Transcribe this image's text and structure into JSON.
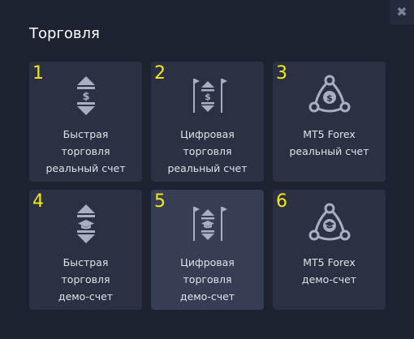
{
  "modal": {
    "title": "Торговля",
    "close_glyph": "✖"
  },
  "cards": [
    {
      "number": "1",
      "icon": "quick-trading-dollar-icon",
      "lines": [
        "Быстрая",
        "торговля",
        "реальный счет"
      ]
    },
    {
      "number": "2",
      "icon": "digital-trading-dollar-icon",
      "lines": [
        "Цифровая",
        "торговля",
        "реальный счет"
      ]
    },
    {
      "number": "3",
      "icon": "mt5-forex-dollar-icon",
      "lines": [
        "MT5 Forex",
        "реальный счет"
      ]
    },
    {
      "number": "4",
      "icon": "quick-trading-demo-icon",
      "lines": [
        "Быстрая",
        "торговля",
        "демо-счет"
      ]
    },
    {
      "number": "5",
      "icon": "digital-trading-demo-icon",
      "lines": [
        "Цифровая",
        "торговля",
        "демо-счет"
      ]
    },
    {
      "number": "6",
      "icon": "mt5-forex-demo-icon",
      "lines": [
        "MT5 Forex",
        "демо-счет"
      ]
    }
  ],
  "colors": {
    "number_marker": "#f2ea18",
    "icon": "#a6b0c2"
  }
}
